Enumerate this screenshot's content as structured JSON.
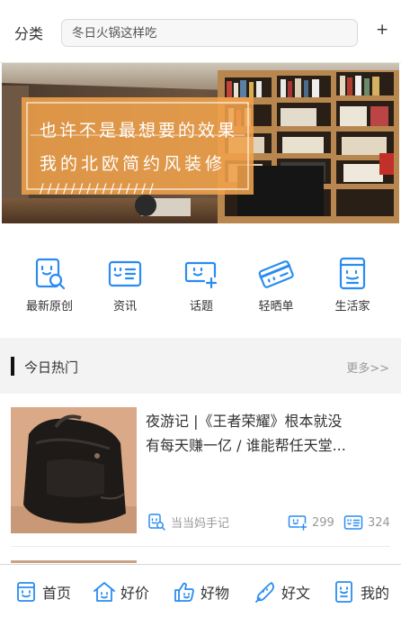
{
  "header": {
    "category_label": "分类",
    "search_placeholder": "冬日火锅这样吃",
    "add_label": "+"
  },
  "banner": {
    "line1": "也许不是最想要的效果",
    "line2": "我的北欧简约风装修",
    "line3": "///////////////"
  },
  "categories": [
    {
      "label": "最新原创",
      "icon": "magnifier-doc-icon"
    },
    {
      "label": "资讯",
      "icon": "news-icon"
    },
    {
      "label": "话题",
      "icon": "chat-add-icon"
    },
    {
      "label": "轻晒单",
      "icon": "ticket-icon"
    },
    {
      "label": "生活家",
      "icon": "journal-icon"
    }
  ],
  "hot": {
    "title": "今日热门",
    "more": "更多>>"
  },
  "article": {
    "title_line1": "夜游记 |《王者荣耀》根本就没",
    "title_line2": "有每天赚一亿 / 谁能帮任天堂...",
    "source": "当当妈手记",
    "likes": "299",
    "comments": "324"
  },
  "tabs": [
    {
      "label": "首页",
      "icon": "home-doc-icon"
    },
    {
      "label": "好价",
      "icon": "house-icon"
    },
    {
      "label": "好物",
      "icon": "thumbs-up-icon"
    },
    {
      "label": "好文",
      "icon": "quill-icon"
    },
    {
      "label": "我的",
      "icon": "profile-icon"
    }
  ],
  "colors": {
    "accent": "#2a8cf0",
    "banner_panel": "#f0a24b"
  }
}
